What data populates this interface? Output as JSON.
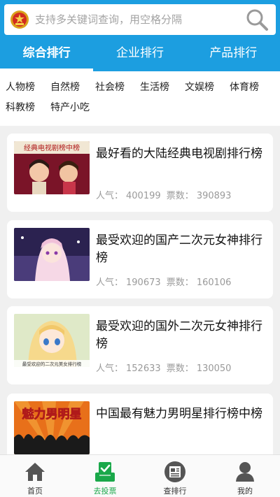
{
  "search": {
    "placeholder": "支持多关键词查询，用空格分隔"
  },
  "tabs": [
    {
      "label": "综合排行",
      "active": true
    },
    {
      "label": "企业排行",
      "active": false
    },
    {
      "label": "产品排行",
      "active": false
    }
  ],
  "categories": {
    "row1": [
      "人物榜",
      "自然榜",
      "社会榜",
      "生活榜",
      "文娱榜",
      "体育榜"
    ],
    "row2": [
      "科教榜",
      "特产小吃"
    ]
  },
  "items": [
    {
      "title": "最好看的大陆经典电视剧排行榜",
      "popularity_label": "人气：",
      "popularity": "400199",
      "votes_label": "票数：",
      "votes": "390893",
      "thumb_caption": "经典电视剧榜中榜"
    },
    {
      "title": "最受欢迎的国产二次元女神排行榜",
      "popularity_label": "人气：",
      "popularity": "190673",
      "votes_label": "票数：",
      "votes": "160106",
      "thumb_caption": ""
    },
    {
      "title": "最受欢迎的国外二次元女神排行榜",
      "popularity_label": "人气：",
      "popularity": "152633",
      "votes_label": "票数：",
      "votes": "130050",
      "thumb_caption": "最受欢迎的二次元美女排行榜"
    },
    {
      "title": "中国最有魅力男明星排行榜中榜",
      "popularity_label": "",
      "popularity": "",
      "votes_label": "",
      "votes": "",
      "thumb_caption": "魅力男明星"
    }
  ],
  "nav": [
    {
      "label": "首页",
      "icon": "home-icon",
      "active": false
    },
    {
      "label": "去投票",
      "icon": "vote-icon",
      "active": true
    },
    {
      "label": "查排行",
      "icon": "ranking-icon",
      "active": false
    },
    {
      "label": "我的",
      "icon": "user-icon",
      "active": false
    }
  ],
  "colors": {
    "primary": "#1c9ee0",
    "nav_active": "#1aa84a",
    "meta": "#9a9a9a"
  }
}
